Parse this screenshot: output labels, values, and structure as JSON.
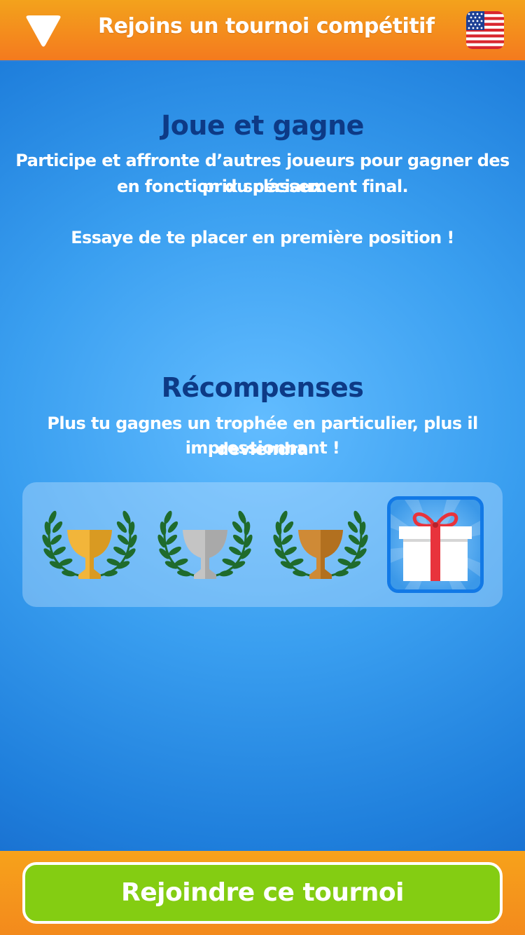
{
  "header": {
    "title": "Rejoins un tournoi compétitif"
  },
  "play_section": {
    "title": "Joue et gagne",
    "line1": "Participe et affronte d’autres joueurs pour gagner des prix spéciaux",
    "line2": "en fonction du classement final.",
    "line3": "Essaye de te placer en première position !"
  },
  "rewards_section": {
    "title": "Récompenses",
    "line1": "Plus tu gagnes un trophée en particulier, plus il deviendra",
    "line2": "impressionnant !"
  },
  "rewards": [
    {
      "icon": "gold-trophy-icon",
      "color": "#f2b53a"
    },
    {
      "icon": "silver-trophy-icon",
      "color": "#bdbdbd"
    },
    {
      "icon": "bronze-trophy-icon",
      "color": "#c9812e"
    },
    {
      "icon": "gift-icon",
      "color": "#e8333c"
    }
  ],
  "footer": {
    "join_label": "Rejoindre ce tournoi"
  },
  "colors": {
    "header_orange": "#f47a1e",
    "title_navy": "#0d3a86",
    "button_green": "#84cd12",
    "laurel_green": "#1f6b2c"
  }
}
